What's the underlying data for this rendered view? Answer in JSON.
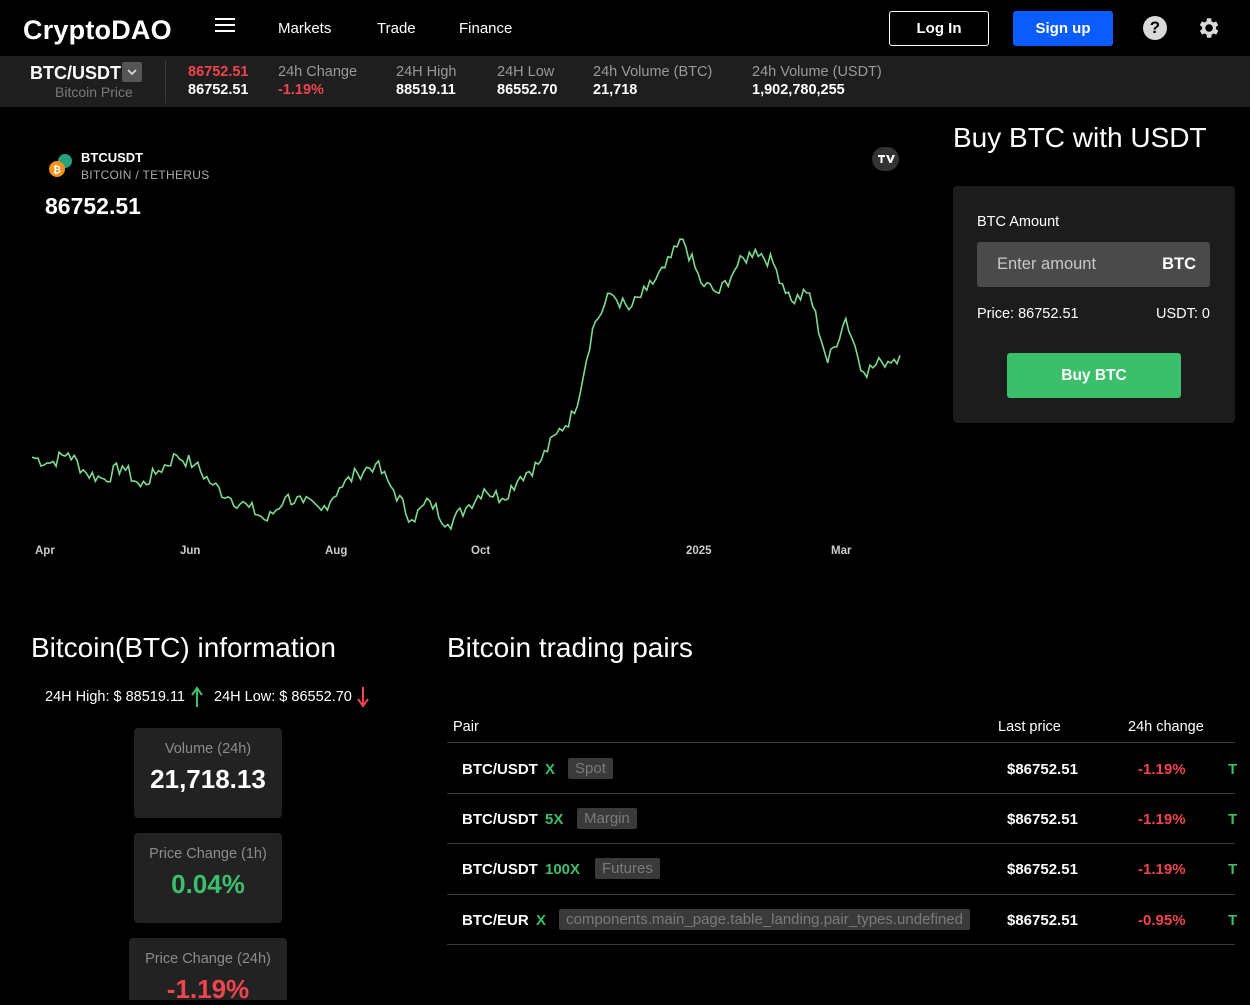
{
  "nav": {
    "logo": "CryptoDAO",
    "links": [
      "Markets",
      "Trade",
      "Finance"
    ],
    "login_label": "Log In",
    "signup_label": "Sign up",
    "help_glyph": "?"
  },
  "ticker": {
    "pair": "BTC/USDT",
    "pair_sub": "Bitcoin Price",
    "last_price_top": "86752.51",
    "last_price_bottom": "86752.51",
    "change_label": "24h Change",
    "change_value": "-1.19%",
    "high_label": "24H High",
    "high_value": "88519.11",
    "low_label": "24H Low",
    "low_value": "86552.70",
    "vol_btc_label": "24h Volume (BTC)",
    "vol_btc_value": "21,718",
    "vol_usdt_label": "24h Volume (USDT)",
    "vol_usdt_value": "1,902,780,255"
  },
  "chart": {
    "symbol": "BTCUSDT",
    "description": "BITCOIN / TETHERUS",
    "price": "86752.51",
    "x_labels": [
      "Apr",
      "Jun",
      "Aug",
      "Oct",
      "2025",
      "Mar"
    ],
    "line_color": "#7ed88f"
  },
  "chart_data": {
    "type": "line",
    "title": "",
    "x": [
      "Apr",
      "Jun",
      "Aug",
      "Oct",
      "2025",
      "Mar"
    ],
    "series": [
      {
        "values": [
          69500,
          68500,
          70200,
          66800,
          65800,
          68000,
          64500,
          67200,
          69800,
          68200,
          64800,
          62500,
          61000,
          58700,
          62700,
          61800,
          60500,
          64300,
          66800,
          68300,
          63900,
          58900,
          62100,
          58100,
          60900,
          64100,
          62500,
          66200,
          68300,
          73400,
          76900,
          91300,
          97200,
          94500,
          97800,
          101600,
          106400,
          99000,
          97300,
          101900,
          104700,
          102300,
          96000,
          97300,
          85500,
          93000,
          83900,
          85600,
          86752
        ]
      }
    ]
  },
  "buy": {
    "title": "Buy BTC with USDT",
    "amount_label": "BTC Amount",
    "amount_placeholder": "Enter amount",
    "amount_unit": "BTC",
    "price_text": "Price: 86752.51",
    "usdt_text": "USDT: 0",
    "button_label": "Buy BTC"
  },
  "info": {
    "title": "Bitcoin(BTC) information",
    "high_text": "24H High: $ 88519.11",
    "low_text": "24H Low: $ 86552.70",
    "cards": [
      {
        "label": "Volume (24h)",
        "value": "21,718.13"
      },
      {
        "label": "Price Change (1h)",
        "value": "0.04%"
      },
      {
        "label": "Price Change (24h)",
        "value": "-1.19%"
      }
    ]
  },
  "pairs": {
    "title": "Bitcoin trading pairs",
    "headers": {
      "pair": "Pair",
      "last_price": "Last price",
      "change": "24h change"
    },
    "rows": [
      {
        "pair": "BTC/USDT",
        "leverage": "X",
        "type": "Spot",
        "price": "$86752.51",
        "change": "-1.19%",
        "action": "T"
      },
      {
        "pair": "BTC/USDT",
        "leverage": "5X",
        "type": "Margin",
        "price": "$86752.51",
        "change": "-1.19%",
        "action": "T"
      },
      {
        "pair": "BTC/USDT",
        "leverage": "100X",
        "type": "Futures",
        "price": "$86752.51",
        "change": "-1.19%",
        "action": "T"
      },
      {
        "pair": "BTC/EUR",
        "leverage": "X",
        "type": "components.main_page.table_landing.pair_types.undefined",
        "price": "$86752.51",
        "change": "-0.95%",
        "action": "T"
      }
    ]
  }
}
